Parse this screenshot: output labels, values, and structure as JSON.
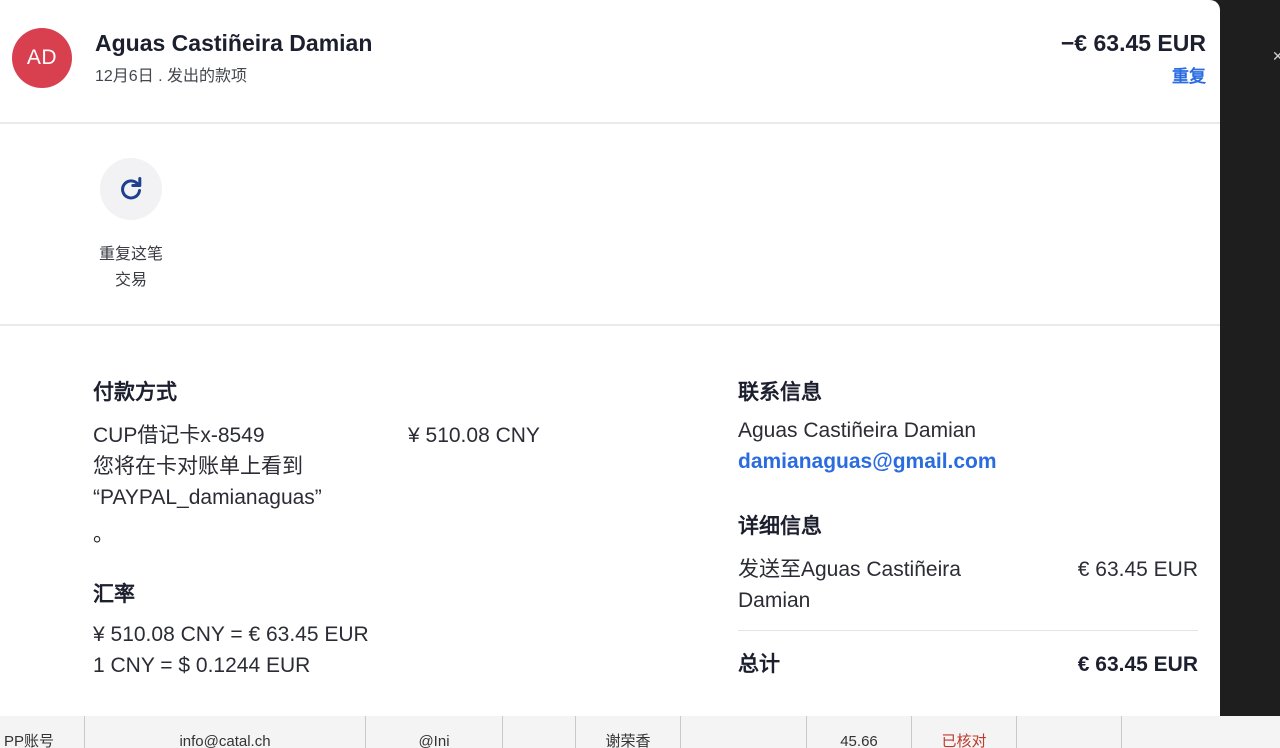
{
  "header": {
    "avatar_initials": "AD",
    "name": "Aguas Castiñeira Damian",
    "meta": "12月6日 . 发出的款项",
    "amount": "−€ 63.45 EUR",
    "repeat_link": "重复",
    "avatar_color": "#d9404f"
  },
  "actions": {
    "repeat_caption_line1": "重复这笔",
    "repeat_caption_line2": "交易",
    "icon": "refresh-icon"
  },
  "payment": {
    "title": "付款方式",
    "card": "CUP借记卡x-8549",
    "card_amount": "¥ 510.08 CNY",
    "statement_line1": "您将在卡对账单上看到",
    "statement_line2": "“PAYPAL_damianaguas”",
    "statement_line3": "。"
  },
  "exchange": {
    "title": "汇率",
    "line1": "¥ 510.08 CNY = € 63.45 EUR",
    "line2": "1 CNY = $ 0.1244 EUR"
  },
  "contact": {
    "title": "联系信息",
    "name": "Aguas Castiñeira Damian",
    "email": "damianaguas@gmail.com"
  },
  "detail": {
    "title": "详细信息",
    "sent_to_line1": "发送至Aguas Castiñeira",
    "sent_to_line2": "Damian",
    "sent_amount": "€ 63.45 EUR",
    "total_label": "总计",
    "total_amount": "€ 63.45 EUR"
  },
  "background_sheet": {
    "cells": [
      "PP账号",
      "info@catal.ch",
      "@Ini",
      "谢荣香",
      "45.66",
      "已核对"
    ]
  },
  "colors": {
    "accent": "#2a6ce0",
    "text": "#1c1f2e"
  }
}
